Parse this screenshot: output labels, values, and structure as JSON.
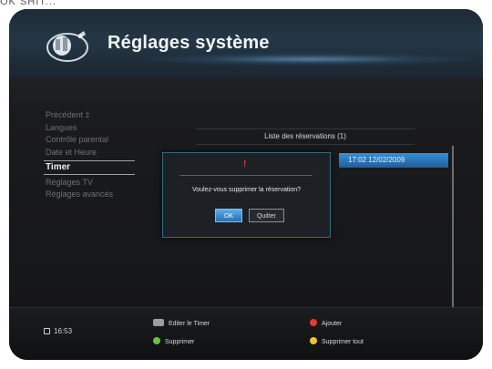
{
  "cut_text": "OK SHIT...",
  "header": {
    "title": "Réglages système"
  },
  "menu": {
    "items": [
      {
        "label": "Précédent ‡",
        "active": false
      },
      {
        "label": "Langues",
        "active": false
      },
      {
        "label": "Contrôle parental",
        "active": false
      },
      {
        "label": "Date et Heure",
        "active": false
      },
      {
        "label": "Timer",
        "active": true
      },
      {
        "label": "Réglages TV",
        "active": false
      },
      {
        "label": "Réglages avancés",
        "active": false
      }
    ]
  },
  "reservations": {
    "title": "Liste des réservations (1)",
    "selected_row_date": "17:02 12/02/2009"
  },
  "dialog": {
    "icon": "!",
    "message": "Voulez-vous supprimer la réservation?",
    "ok_label": "OK",
    "cancel_label": "Quitter"
  },
  "footer": {
    "time": "16:53",
    "legend": [
      {
        "label": "Editer le Timer",
        "color": "#9a9da1",
        "kind": "key"
      },
      {
        "label": "Ajouter",
        "color": "#e03b2f",
        "kind": "dot"
      },
      {
        "label": "Supprimer",
        "color": "#6cc04a",
        "kind": "dot"
      },
      {
        "label": "Supprimer tout",
        "color": "#f2c230",
        "kind": "dot"
      }
    ]
  },
  "colors": {
    "accent": "#2f7fc4",
    "header": "#243746",
    "background": "#141516"
  }
}
